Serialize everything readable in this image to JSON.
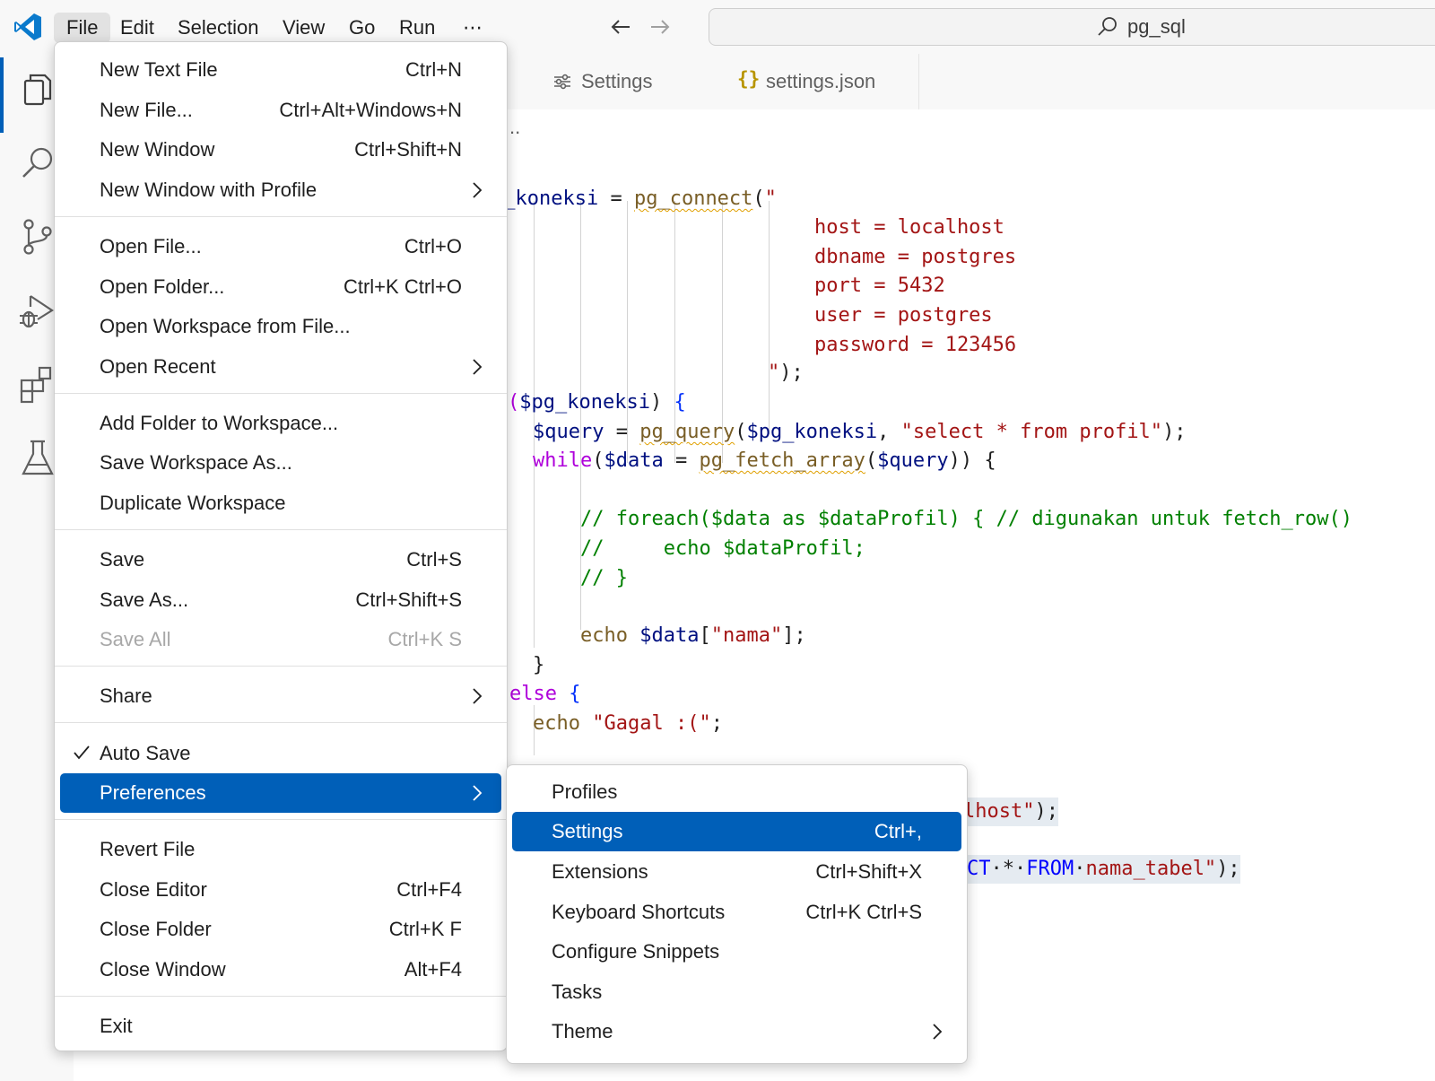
{
  "titlebar": {
    "menus": [
      "File",
      "Edit",
      "Selection",
      "View",
      "Go",
      "Run",
      "⋯"
    ],
    "search_text": "pg_sql"
  },
  "activity_icons": [
    "explorer-icon",
    "search-icon",
    "source-control-icon",
    "run-debug-icon",
    "extensions-icon",
    "testing-icon"
  ],
  "tabs": {
    "close_glyph": "✕",
    "items": [
      {
        "label": "Settings",
        "icon": "settings-editor-icon"
      },
      {
        "label": "settings.json",
        "icon": "json-braces-icon",
        "icon_glyph": "{}"
      }
    ]
  },
  "code": {
    "breadcrumb": "..",
    "lines": [
      {
        "parts": [
          [
            "c-var",
            "g_koneksi"
          ],
          [
            "c-def",
            " = "
          ],
          [
            "c-fn squig",
            "pg_connect"
          ],
          [
            "c-def",
            "("
          ],
          [
            "c-str",
            "\""
          ]
        ]
      },
      {
        "parts": [
          [
            "c-str",
            "host = localhost"
          ]
        ]
      },
      {
        "parts": [
          [
            "c-str",
            "dbname = postgres"
          ]
        ]
      },
      {
        "parts": [
          [
            "c-str",
            "port = 5432"
          ]
        ]
      },
      {
        "parts": [
          [
            "c-str",
            "user = postgres"
          ]
        ]
      },
      {
        "parts": [
          [
            "c-str",
            "password = 123456"
          ]
        ]
      },
      {
        "parts": [
          [
            "c-str",
            "\""
          ],
          [
            "c-def",
            ");"
          ]
        ]
      },
      {
        "parts": [
          [
            "c-kw",
            "("
          ],
          [
            "c-var",
            "$pg_koneksi"
          ],
          [
            "c-def",
            ") "
          ],
          [
            "c-brk",
            "{"
          ]
        ]
      },
      {
        "parts": [
          [
            "c-var",
            "$query"
          ],
          [
            "c-def",
            " = "
          ],
          [
            "c-fn squig",
            "pg_query"
          ],
          [
            "c-def",
            "("
          ],
          [
            "c-var",
            "$pg_koneksi"
          ],
          [
            "c-def",
            ", "
          ],
          [
            "c-str",
            "\"select * from profil\""
          ],
          [
            "c-def",
            ");"
          ]
        ]
      },
      {
        "parts": [
          [
            "c-kw",
            "while"
          ],
          [
            "c-def",
            "("
          ],
          [
            "c-var",
            "$data"
          ],
          [
            "c-def",
            " = "
          ],
          [
            "c-fn squig",
            "pg_fetch_array"
          ],
          [
            "c-def",
            "("
          ],
          [
            "c-var",
            "$query"
          ],
          [
            "c-def",
            "))"
          ],
          [
            "c-def",
            " {"
          ]
        ]
      },
      {
        "parts": [
          [
            "c-com",
            "// foreach($data as $dataProfil) { // digunakan untuk fetch_row()"
          ]
        ]
      },
      {
        "parts": [
          [
            "c-com",
            "//     echo $dataProfil;"
          ]
        ]
      },
      {
        "parts": [
          [
            "c-com",
            "// }"
          ]
        ]
      },
      {
        "parts": [
          [
            "c-fn",
            "echo "
          ],
          [
            "c-var",
            "$data"
          ],
          [
            "c-def",
            "["
          ],
          [
            "c-str",
            "\"nama\""
          ],
          [
            "c-def",
            "];"
          ]
        ]
      },
      {
        "parts": [
          [
            "c-def",
            "}"
          ]
        ]
      },
      {
        "parts": [
          [
            "c-kw",
            "else "
          ],
          [
            "c-brk",
            "{"
          ]
        ]
      },
      {
        "parts": [
          [
            "c-fn",
            "echo "
          ],
          [
            "c-str",
            "\"Gagal :(\""
          ],
          [
            "c-def",
            ";"
          ]
        ]
      },
      {
        "parts": [
          [
            "c-str",
            "lhost\""
          ],
          [
            "c-def",
            ");"
          ]
        ]
      },
      {
        "parts": [
          [
            "c-blue",
            "CT"
          ],
          [
            "c-def",
            "·*·"
          ],
          [
            "c-blue",
            "FROM"
          ],
          [
            "c-def",
            "·"
          ],
          [
            "c-str",
            "nama_tabel\""
          ],
          [
            "c-def",
            ");"
          ]
        ]
      }
    ]
  },
  "file_menu": {
    "groups": [
      [
        {
          "label": "New Text File",
          "shortcut": "Ctrl+N"
        },
        {
          "label": "New File...",
          "shortcut": "Ctrl+Alt+Windows+N"
        },
        {
          "label": "New Window",
          "shortcut": "Ctrl+Shift+N"
        },
        {
          "label": "New Window with Profile",
          "submenu": true
        }
      ],
      [
        {
          "label": "Open File...",
          "shortcut": "Ctrl+O"
        },
        {
          "label": "Open Folder...",
          "shortcut": "Ctrl+K Ctrl+O"
        },
        {
          "label": "Open Workspace from File..."
        },
        {
          "label": "Open Recent",
          "submenu": true
        }
      ],
      [
        {
          "label": "Add Folder to Workspace..."
        },
        {
          "label": "Save Workspace As..."
        },
        {
          "label": "Duplicate Workspace"
        }
      ],
      [
        {
          "label": "Save",
          "shortcut": "Ctrl+S"
        },
        {
          "label": "Save As...",
          "shortcut": "Ctrl+Shift+S"
        },
        {
          "label": "Save All",
          "shortcut": "Ctrl+K S",
          "disabled": true
        }
      ],
      [
        {
          "label": "Share",
          "submenu": true
        }
      ],
      [
        {
          "label": "Auto Save",
          "checked": true
        },
        {
          "label": "Preferences",
          "submenu": true,
          "selected": true
        }
      ],
      [
        {
          "label": "Revert File"
        },
        {
          "label": "Close Editor",
          "shortcut": "Ctrl+F4"
        },
        {
          "label": "Close Folder",
          "shortcut": "Ctrl+K F"
        },
        {
          "label": "Close Window",
          "shortcut": "Alt+F4"
        }
      ],
      [
        {
          "label": "Exit"
        }
      ]
    ]
  },
  "preferences_menu": {
    "items": [
      {
        "label": "Profiles"
      },
      {
        "label": "Settings",
        "shortcut": "Ctrl+,",
        "selected": true
      },
      {
        "label": "Extensions",
        "shortcut": "Ctrl+Shift+X"
      },
      {
        "label": "Keyboard Shortcuts",
        "shortcut": "Ctrl+K Ctrl+S"
      },
      {
        "label": "Configure Snippets"
      },
      {
        "label": "Tasks"
      },
      {
        "label": "Theme",
        "submenu": true
      }
    ]
  },
  "colors": {
    "accent": "#005fb8",
    "string": "#a31515",
    "variable": "#001080",
    "function": "#795e26",
    "keyword": "#af00db",
    "comment": "#008000"
  }
}
